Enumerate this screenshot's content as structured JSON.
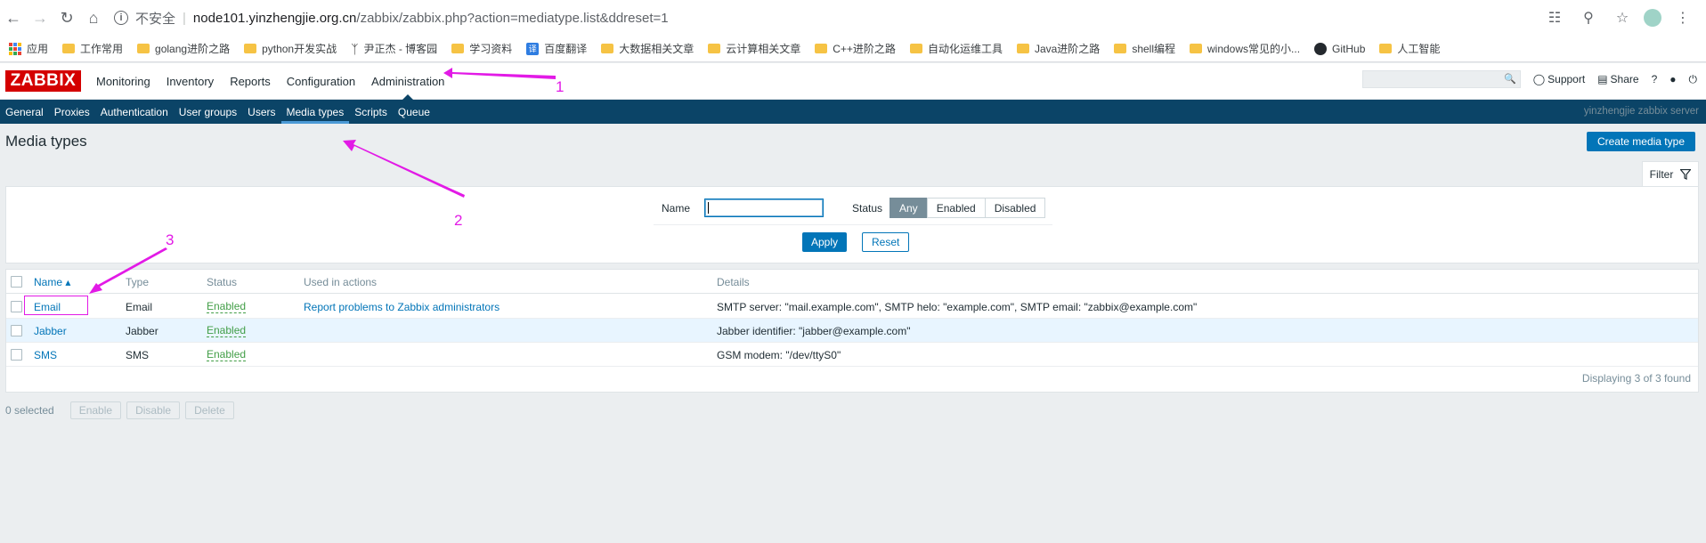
{
  "browser": {
    "insecure_label": "不安全",
    "url_host": "node101.yinzhengjie.org.cn",
    "url_path": "/zabbix/zabbix.php?action=mediatype.list&ddreset=1",
    "bookmarks": [
      "应用",
      "工作常用",
      "golang进阶之路",
      "python开发实战",
      "尹正杰 - 博客园",
      "学习资料",
      "百度翻译",
      "大数据相关文章",
      "云计算相关文章",
      "C++进阶之路",
      "自动化运维工具",
      "Java进阶之路",
      "shell编程",
      "windows常见的小...",
      "GitHub",
      "人工智能"
    ],
    "fanyi_badge": "译"
  },
  "header": {
    "logo": "ZABBIX",
    "nav": [
      "Monitoring",
      "Inventory",
      "Reports",
      "Configuration",
      "Administration"
    ],
    "support": "Support",
    "share": "Share",
    "help": "?"
  },
  "subnav": {
    "items": [
      "General",
      "Proxies",
      "Authentication",
      "User groups",
      "Users",
      "Media types",
      "Scripts",
      "Queue"
    ],
    "server_name": "yinzhengjie zabbix server"
  },
  "page": {
    "title": "Media types",
    "create_button": "Create media type"
  },
  "filter": {
    "tab_label": "Filter",
    "name_label": "Name",
    "name_value": "",
    "status_label": "Status",
    "status_options": [
      "Any",
      "Enabled",
      "Disabled"
    ],
    "status_selected": "Any",
    "apply": "Apply",
    "reset": "Reset"
  },
  "table": {
    "headers": [
      "Name ▴",
      "Type",
      "Status",
      "Used in actions",
      "Details"
    ],
    "rows": [
      {
        "name": "Email",
        "type": "Email",
        "status": "Enabled",
        "actions": "Report problems to Zabbix administrators",
        "details": "SMTP server: \"mail.example.com\", SMTP helo: \"example.com\", SMTP email: \"zabbix@example.com\""
      },
      {
        "name": "Jabber",
        "type": "Jabber",
        "status": "Enabled",
        "actions": "",
        "details": "Jabber identifier: \"jabber@example.com\""
      },
      {
        "name": "SMS",
        "type": "SMS",
        "status": "Enabled",
        "actions": "",
        "details": "GSM modem: \"/dev/ttyS0\""
      }
    ],
    "footer": "Displaying 3 of 3 found"
  },
  "bulk": {
    "selected": "0 selected",
    "enable": "Enable",
    "disable": "Disable",
    "delete": "Delete"
  },
  "annotations": {
    "labels": [
      "1",
      "2",
      "3"
    ],
    "color": "#e21ae6"
  }
}
